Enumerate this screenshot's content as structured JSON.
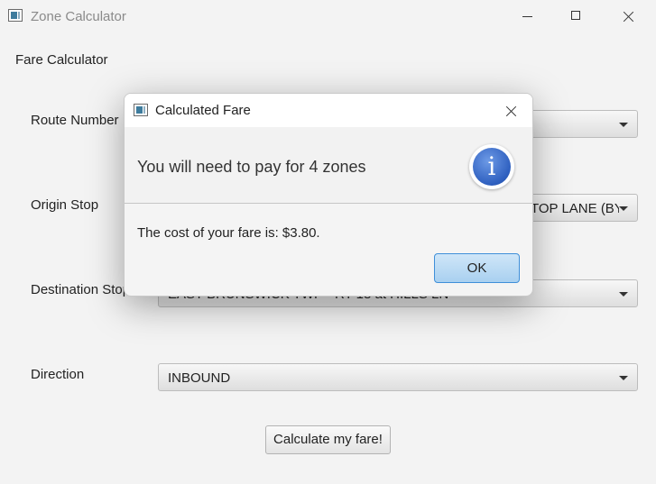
{
  "window": {
    "title": "Zone Calculator"
  },
  "form": {
    "heading": "Fare Calculator",
    "route_label": "Route Number",
    "route_value": "",
    "origin_label": "Origin Stop",
    "origin_value": "TOP LANE (BY ...",
    "destination_label": "Destination Stop",
    "destination_value": "EAST BRUNSWICK TWP - RT 18 at HILLS LN",
    "direction_label": "Direction",
    "direction_value": "INBOUND",
    "calculate_label": "Calculate my fare!"
  },
  "dialog": {
    "title": "Calculated Fare",
    "header": "You will need to pay for 4 zones",
    "content": "The cost of your fare is: $3.80.",
    "ok_label": "OK",
    "icon": "info-icon",
    "icon_glyph": "i"
  }
}
